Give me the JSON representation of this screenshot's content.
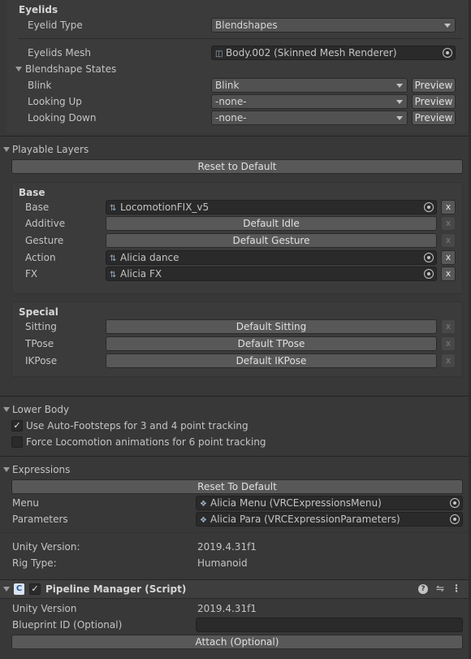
{
  "eyelids": {
    "header": "Eyelids",
    "eyelid_type_label": "Eyelid Type",
    "eyelid_type_value": "Blendshapes",
    "eyelids_mesh_label": "Eyelids Mesh",
    "eyelids_mesh_value": "Body.002 (Skinned Mesh Renderer)",
    "blendshape_states_label": "Blendshape States",
    "rows": [
      {
        "label": "Blink",
        "value": "Blink",
        "button": "Preview"
      },
      {
        "label": "Looking Up",
        "value": "-none-",
        "button": "Preview"
      },
      {
        "label": "Looking Down",
        "value": "-none-",
        "button": "Preview"
      }
    ]
  },
  "playable_layers": {
    "header": "Playable Layers",
    "reset_button": "Reset to Default",
    "base_header": "Base",
    "base_rows": [
      {
        "label": "Base",
        "value": "LocomotionFIX_v5",
        "kind": "field"
      },
      {
        "label": "Additive",
        "value": "Default Idle",
        "kind": "button"
      },
      {
        "label": "Gesture",
        "value": "Default Gesture",
        "kind": "button"
      },
      {
        "label": "Action",
        "value": "Alicia dance",
        "kind": "field"
      },
      {
        "label": "FX",
        "value": "Alicia FX",
        "kind": "field"
      }
    ],
    "special_header": "Special",
    "special_rows": [
      {
        "label": "Sitting",
        "value": "Default Sitting"
      },
      {
        "label": "TPose",
        "value": "Default TPose"
      },
      {
        "label": "IKPose",
        "value": "Default IKPose"
      }
    ],
    "clear_glyph": "x"
  },
  "lower_body": {
    "header": "Lower Body",
    "options": [
      {
        "label": "Use Auto-Footsteps for 3 and 4 point tracking",
        "checked": true
      },
      {
        "label": "Force Locomotion animations for 6 point tracking",
        "checked": false
      }
    ]
  },
  "expressions": {
    "header": "Expressions",
    "reset_button": "Reset To Default",
    "menu_label": "Menu",
    "menu_value": "Alicia Menu (VRCExpressionsMenu)",
    "parameters_label": "Parameters",
    "parameters_value": "Alicia Para (VRCExpressionParameters)"
  },
  "info": {
    "unity_version_label": "Unity Version:",
    "unity_version_value": "2019.4.31f1",
    "rig_type_label": "Rig Type:",
    "rig_type_value": "Humanoid"
  },
  "pipeline": {
    "title": "Pipeline Manager (Script)",
    "unity_version_label": "Unity Version",
    "unity_version_value": "2019.4.31f1",
    "blueprint_label": "Blueprint ID (Optional)",
    "blueprint_value": "",
    "attach_button": "Attach (Optional)",
    "header_icons": [
      "help-icon",
      "presets-icon",
      "kebab-menu-icon"
    ]
  },
  "colors": {
    "background": "#383838",
    "field": "#2a2a2a",
    "button": "#585858",
    "header_bg": "#3e3e3e",
    "text": "#c4c4c4"
  }
}
